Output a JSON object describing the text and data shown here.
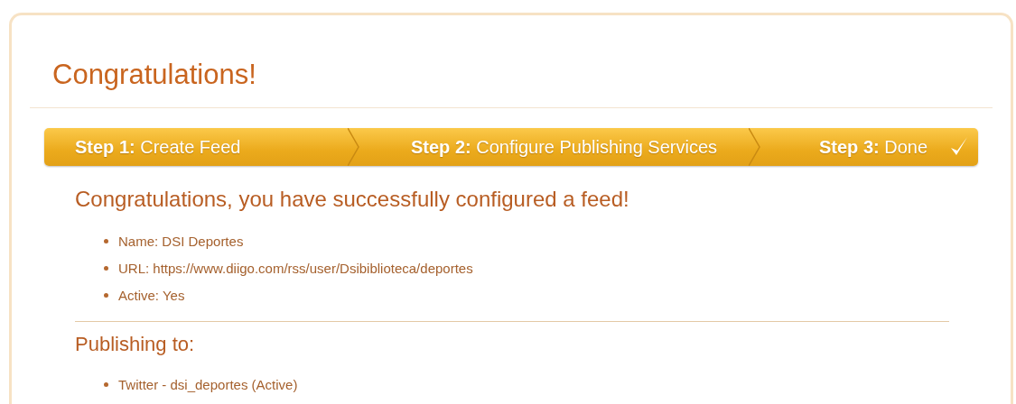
{
  "title": "Congratulations!",
  "steps": [
    {
      "label": "**Step 1:** Create Feed",
      "checked": false
    },
    {
      "label": "**Step 2:** Configure Publishing Services",
      "checked": false
    },
    {
      "label": "**Step 3:** Done",
      "checked": true
    }
  ],
  "message": "Congratulations, you have successfully configured a feed!",
  "feed_details": [
    "Name: DSI Deportes",
    "URL: https://www.diigo.com/rss/user/Dsibiblioteca/deportes",
    "Active: Yes"
  ],
  "publishing_heading": "Publishing to:",
  "publishing_services": [
    "Twitter - dsi_deportes (Active)"
  ]
}
